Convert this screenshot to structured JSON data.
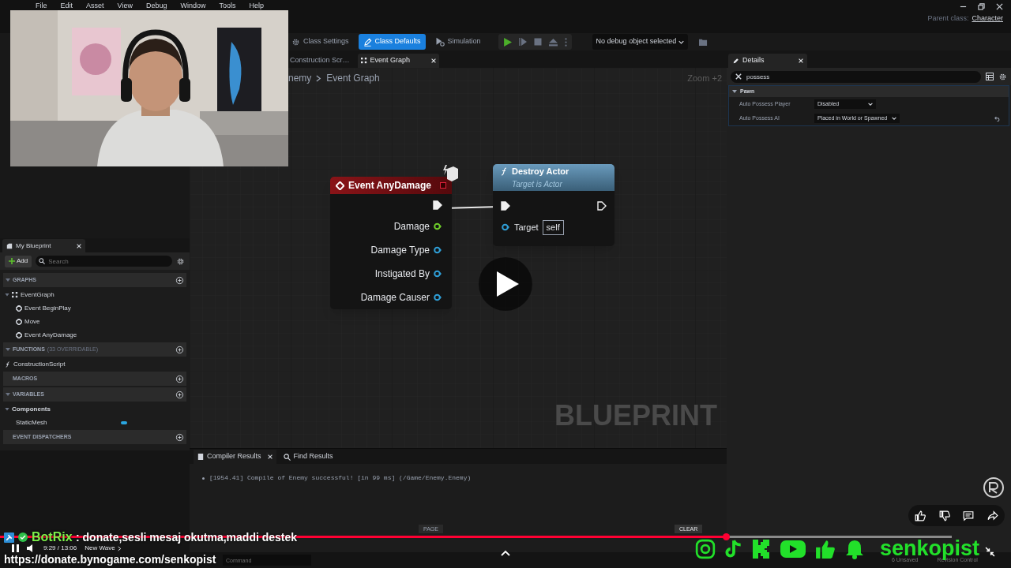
{
  "menu": [
    "File",
    "Edit",
    "Asset",
    "View",
    "Debug",
    "Window",
    "Tools",
    "Help"
  ],
  "parent_class": {
    "label": "Parent class:",
    "value": "Character"
  },
  "toolbar": {
    "buttons": [
      {
        "label": "Class Settings",
        "kind": "settings",
        "selected": false
      },
      {
        "label": "Class Defaults",
        "kind": "defaults",
        "selected": true
      },
      {
        "label": "Simulation",
        "kind": "simulation",
        "selected": false
      }
    ],
    "debug_dropdown": "No debug object selected"
  },
  "graph_tabs": [
    {
      "label": "Construction Scr…",
      "selected": false,
      "closable": false
    },
    {
      "label": "Event Graph",
      "selected": true,
      "closable": true
    }
  ],
  "breadcrumb": [
    "nemy",
    "Event Graph"
  ],
  "zoom": "Zoom +2",
  "graph_label": "BLUEPRINT",
  "nodes": [
    {
      "kind": "event",
      "title": "Event AnyDamage",
      "pins": [
        {
          "label": "Damage",
          "color": "#6fcf2a"
        },
        {
          "label": "Damage Type",
          "color": "#2f9fd8"
        },
        {
          "label": "Instigated By",
          "color": "#2f9fd8"
        },
        {
          "label": "Damage Causer",
          "color": "#2f9fd8"
        }
      ]
    },
    {
      "kind": "function",
      "title": "Destroy Actor",
      "subtitle": "Target is Actor",
      "pins": [
        {
          "label": "Target",
          "value": "self",
          "color": "#2f9fd8"
        }
      ]
    }
  ],
  "my_blueprint": {
    "title": "My Blueprint",
    "add": "Add",
    "search_placeholder": "Search",
    "sections": [
      {
        "label": "GRAPHS",
        "expanded": true,
        "items": [
          {
            "label": "EventGraph",
            "kind": "graph",
            "children": [
              {
                "label": "Event BeginPlay",
                "kind": "event"
              },
              {
                "label": "Move",
                "kind": "event"
              },
              {
                "label": "Event AnyDamage",
                "kind": "event"
              }
            ]
          }
        ]
      },
      {
        "label": "FUNCTIONS",
        "note": "(33 OVERRIDABLE)",
        "expanded": true,
        "items": [
          {
            "label": "ConstructionScript",
            "kind": "function"
          }
        ]
      },
      {
        "label": "MACROS",
        "expanded": false
      },
      {
        "label": "VARIABLES",
        "expanded": true,
        "items": [
          {
            "label": "Components",
            "kind": "category",
            "children": [
              {
                "label": "StaticMesh",
                "kind": "variable"
              }
            ]
          }
        ]
      },
      {
        "label": "EVENT DISPATCHERS",
        "expanded": false
      }
    ]
  },
  "details": {
    "title": "Details",
    "search": "possess",
    "category": "Pawn",
    "properties": [
      {
        "label": "Auto Possess Player",
        "value": "Disabled",
        "reset": false
      },
      {
        "label": "Auto Possess AI",
        "value": "Placed in World or Spawned",
        "reset": true
      }
    ]
  },
  "bottom_tabs": [
    {
      "label": "Compiler Results",
      "selected": true
    },
    {
      "label": "Find Results",
      "selected": false
    }
  ],
  "log": [
    "[1954.41] Compile of Enemy successful! [in 99 ms] (/Game/Enemy.Enemy)"
  ],
  "page_button": "PAGE",
  "clear_button": "CLEAR",
  "command_placeholder": "Command",
  "status": {
    "unsaved": "6 Unsaved",
    "revision": "Revision Control"
  },
  "player": {
    "progress": {
      "level": 0.763
    },
    "time": "9:29 / 13:06",
    "chapter": "New Wave"
  },
  "chat": {
    "user": "BotRix",
    "message": ": donate,sesli mesaj okutma,maddi destek"
  },
  "donate_url": "https://donate.bynogame.com/senkopist",
  "social_handle": "senkopist"
}
